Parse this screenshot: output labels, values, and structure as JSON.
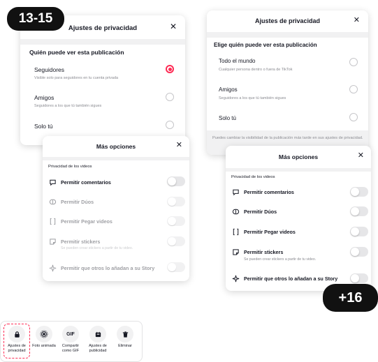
{
  "badges": {
    "top_left": "13-15",
    "bottom_right": "+16"
  },
  "panel_a": {
    "title": "Ajustes de privacidad",
    "close": "✕",
    "section": "Quién puede ver esta publicación",
    "options": [
      {
        "label": "Seguidores",
        "sub": "Visible solo para seguidores en tu cuenta privada",
        "selected": true
      },
      {
        "label": "Amigos",
        "sub": "Seguidores a los que tú también sigues",
        "selected": false
      },
      {
        "label": "Solo tú",
        "sub": "",
        "selected": false
      }
    ]
  },
  "panel_b": {
    "title": "Ajustes de privacidad",
    "close": "✕",
    "section": "Elige quién puede ver esta publicación",
    "options": [
      {
        "label": "Todo el mundo",
        "sub": "Cualquier persona dentro o fuera de TikTok",
        "selected": false
      },
      {
        "label": "Amigos",
        "sub": "Seguidores a los que tú también sigues",
        "selected": false
      },
      {
        "label": "Solo tú",
        "sub": "",
        "selected": false
      }
    ],
    "footer": "Puedes cambiar la visibilidad de la publicación más tarde en sus ajustes de privacidad."
  },
  "more_a": {
    "title": "Más opciones",
    "close": "✕",
    "section": "Privacidad de los videos",
    "items": [
      {
        "label": "Permitir comentarios",
        "icon": "comment-icon",
        "enabled": true
      },
      {
        "label": "Permitir Dúos",
        "icon": "duet-icon",
        "enabled": false
      },
      {
        "label": "Permitir Pegar videos",
        "icon": "stitch-icon",
        "enabled": false
      },
      {
        "label": "Permitir stickers",
        "icon": "sticker-icon",
        "enabled": false,
        "sub": "Se pueden crear stickers a partir de tu video."
      },
      {
        "label": "Permitir que otros lo añadan a su Story",
        "icon": "sparkle-icon",
        "enabled": false
      }
    ]
  },
  "more_b": {
    "title": "Más opciones",
    "close": "✕",
    "section": "Privacidad de los videos",
    "items": [
      {
        "label": "Permitir comentarios",
        "icon": "comment-icon",
        "enabled": true
      },
      {
        "label": "Permitir Dúos",
        "icon": "duet-icon",
        "enabled": true
      },
      {
        "label": "Permitir Pegar videos",
        "icon": "stitch-icon",
        "enabled": true
      },
      {
        "label": "Permitir stickers",
        "icon": "sticker-icon",
        "enabled": true,
        "sub": "Se pueden crear stickers a partir de tu video."
      },
      {
        "label": "Permitir que otros lo añadan a su Story",
        "icon": "sparkle-icon",
        "enabled": true
      }
    ]
  },
  "toolbar": {
    "items": [
      {
        "label": "Ajustes de privacidad",
        "icon": "lock-icon",
        "selected": true
      },
      {
        "label": "Foto animada",
        "icon": "live-photo-icon",
        "selected": false
      },
      {
        "label": "Compartir como GIF",
        "icon": "gif-icon",
        "glyph": "GIF",
        "selected": false
      },
      {
        "label": "Ajustes de publicidad",
        "icon": "ad-icon",
        "selected": false
      },
      {
        "label": "Eliminar",
        "icon": "trash-icon",
        "selected": false
      }
    ]
  },
  "colors": {
    "accent": "#fe2c55",
    "text": "#161823",
    "muted": "#8a8b91",
    "badge": "#111111"
  }
}
